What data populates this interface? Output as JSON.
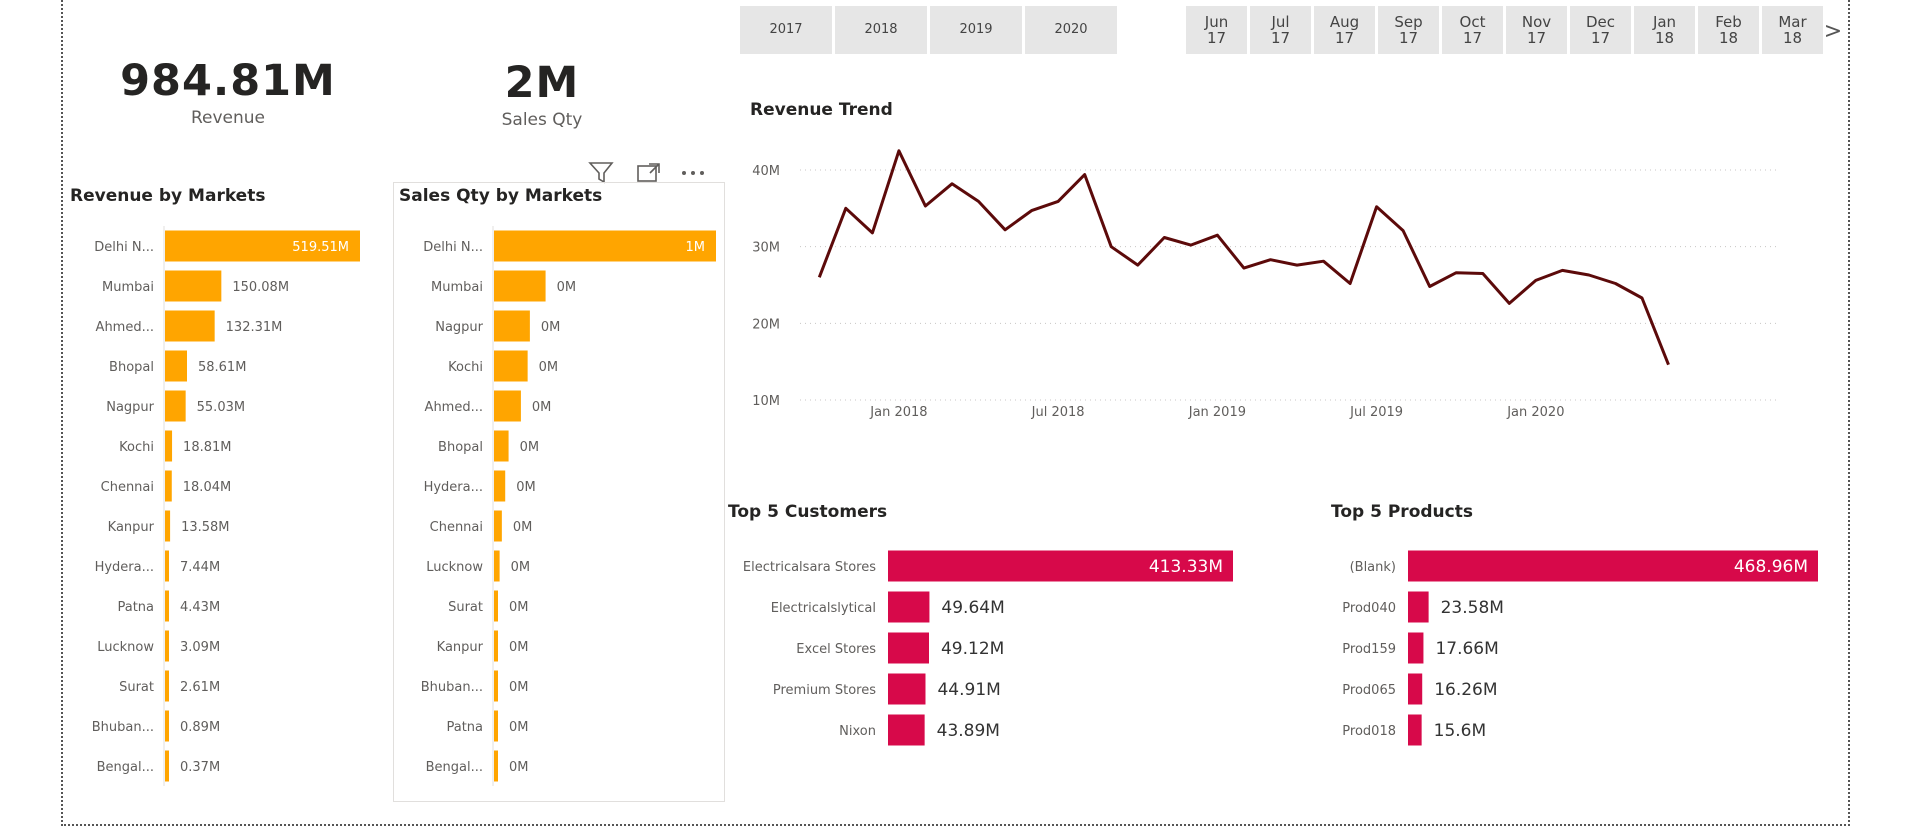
{
  "kpis": {
    "revenue": {
      "value": "984.81M",
      "label": "Revenue"
    },
    "sales_qty": {
      "value": "2M",
      "label": "Sales Qty"
    }
  },
  "year_slicer": [
    "2017",
    "2018",
    "2019",
    "2020"
  ],
  "month_slicer": [
    {
      "m": "Jun",
      "y": "17"
    },
    {
      "m": "Jul",
      "y": "17"
    },
    {
      "m": "Aug",
      "y": "17"
    },
    {
      "m": "Sep",
      "y": "17"
    },
    {
      "m": "Oct",
      "y": "17"
    },
    {
      "m": "Nov",
      "y": "17"
    },
    {
      "m": "Dec",
      "y": "17"
    },
    {
      "m": "Jan",
      "y": "18"
    },
    {
      "m": "Feb",
      "y": "18"
    },
    {
      "m": "Mar",
      "y": "18"
    }
  ],
  "month_next_glyph": ">",
  "colors": {
    "amber": "#FFA500",
    "crimson": "#D7094A",
    "trend": "#5C0A0A"
  },
  "icons": [
    "filter-icon",
    "focus-mode-icon",
    "more-options-icon"
  ],
  "chart_data": [
    {
      "type": "bar",
      "orientation": "horizontal",
      "title": "Revenue by Markets",
      "categories": [
        "Delhi N...",
        "Mumbai",
        "Ahmed...",
        "Bhopal",
        "Nagpur",
        "Kochi",
        "Chennai",
        "Kanpur",
        "Hydera...",
        "Patna",
        "Lucknow",
        "Surat",
        "Bhuban...",
        "Bengal..."
      ],
      "values": [
        519.51,
        150.08,
        132.31,
        58.61,
        55.03,
        18.81,
        18.04,
        13.58,
        7.44,
        4.43,
        3.09,
        2.61,
        0.89,
        0.37
      ],
      "labels": [
        "519.51M",
        "150.08M",
        "132.31M",
        "58.61M",
        "55.03M",
        "18.81M",
        "18.04M",
        "13.58M",
        "7.44M",
        "4.43M",
        "3.09M",
        "2.61M",
        "0.89M",
        "0.37M"
      ],
      "unit": "M",
      "color": "#FFA500"
    },
    {
      "type": "bar",
      "orientation": "horizontal",
      "title": "Sales Qty by Markets",
      "categories": [
        "Delhi N...",
        "Mumbai",
        "Nagpur",
        "Kochi",
        "Ahmed...",
        "Bhopal",
        "Hydera...",
        "Chennai",
        "Lucknow",
        "Surat",
        "Kanpur",
        "Bhuban...",
        "Patna",
        "Bengal..."
      ],
      "values": [
        0.99,
        0.23,
        0.16,
        0.15,
        0.12,
        0.065,
        0.05,
        0.035,
        0.025,
        0.015,
        0.012,
        0.01,
        0.006,
        0.004
      ],
      "labels": [
        "1M",
        "0M",
        "0M",
        "0M",
        "0M",
        "0M",
        "0M",
        "0M",
        "0M",
        "0M",
        "0M",
        "0M",
        "0M",
        "0M"
      ],
      "color": "#FFA500"
    },
    {
      "type": "line",
      "title": "Revenue Trend",
      "x_ticks": [
        "Jan 2018",
        "Jul 2018",
        "Jan 2019",
        "Jul 2019",
        "Jan 2020"
      ],
      "y_ticks": [
        "10M",
        "20M",
        "30M",
        "40M"
      ],
      "ylim": [
        10,
        40
      ],
      "x": [
        "2017-10",
        "2017-11",
        "2017-12",
        "2018-01",
        "2018-02",
        "2018-03",
        "2018-04",
        "2018-05",
        "2018-06",
        "2018-07",
        "2018-08",
        "2018-09",
        "2018-10",
        "2018-11",
        "2018-12",
        "2019-01",
        "2019-02",
        "2019-03",
        "2019-04",
        "2019-05",
        "2019-06",
        "2019-07",
        "2019-08",
        "2019-09",
        "2019-10",
        "2019-11",
        "2019-12",
        "2020-01",
        "2020-02",
        "2020-03",
        "2020-04",
        "2020-05",
        "2020-06"
      ],
      "values": [
        26,
        35,
        31.8,
        42.5,
        35.3,
        38.2,
        35.9,
        32.2,
        34.7,
        35.9,
        39.4,
        30,
        27.6,
        31.2,
        30.2,
        31.5,
        27.2,
        28.3,
        27.6,
        28.1,
        25.2,
        35.2,
        32.1,
        24.8,
        26.6,
        26.5,
        22.6,
        25.6,
        26.9,
        26.3,
        25.2,
        23.3,
        14.6
      ],
      "grid": true,
      "color": "#5C0A0A"
    },
    {
      "type": "bar",
      "orientation": "horizontal",
      "title": "Top 5 Customers",
      "categories": [
        "Electricalsara Stores",
        "Electricalslytical",
        "Excel Stores",
        "Premium Stores",
        "Nixon"
      ],
      "values": [
        413.33,
        49.64,
        49.12,
        44.91,
        43.89
      ],
      "labels": [
        "413.33M",
        "49.64M",
        "49.12M",
        "44.91M",
        "43.89M"
      ],
      "unit": "M",
      "color": "#D7094A"
    },
    {
      "type": "bar",
      "orientation": "horizontal",
      "title": "Top 5 Products",
      "categories": [
        "(Blank)",
        "Prod040",
        "Prod159",
        "Prod065",
        "Prod018"
      ],
      "values": [
        468.96,
        23.58,
        17.66,
        16.26,
        15.6
      ],
      "labels": [
        "468.96M",
        "23.58M",
        "17.66M",
        "16.26M",
        "15.6M"
      ],
      "unit": "M",
      "color": "#D7094A"
    }
  ]
}
